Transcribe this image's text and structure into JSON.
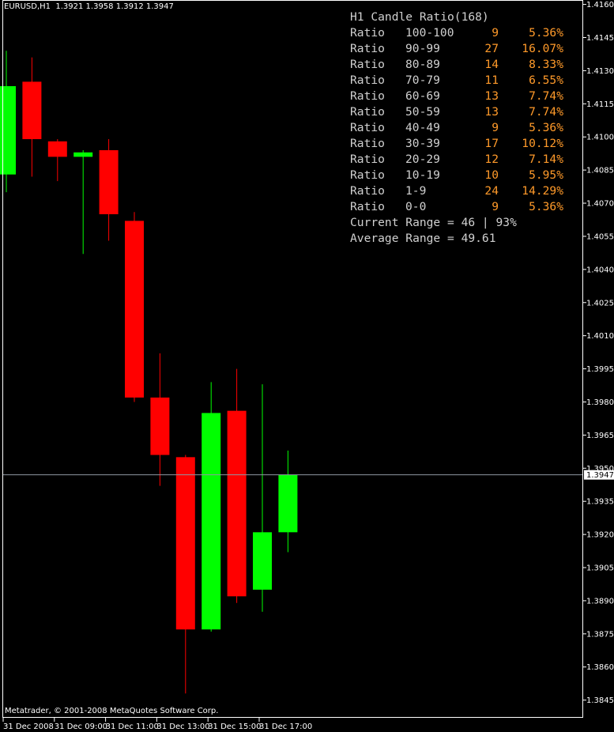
{
  "header": {
    "symbol_line": "EURUSD,H1  1.3921 1.3958 1.3912 1.3947"
  },
  "footer": {
    "copyright": "Metatrader, © 2001-2008 MetaQuotes Software Corp."
  },
  "colors": {
    "bull": "#00ff00",
    "bear": "#ff0000",
    "axis": "#ffffff",
    "price_line": "#8f97a3",
    "panel_text": "#d0d0d0",
    "panel_value": "#ff9a2a"
  },
  "ratio_panel": {
    "title": "H1 Candle Ratio(168)",
    "rows": [
      {
        "label": "Ratio",
        "bucket": "100-100",
        "count": "9",
        "pct": "5.36%"
      },
      {
        "label": "Ratio",
        "bucket": "90-99",
        "count": "27",
        "pct": "16.07%"
      },
      {
        "label": "Ratio",
        "bucket": "80-89",
        "count": "14",
        "pct": "8.33%"
      },
      {
        "label": "Ratio",
        "bucket": "70-79",
        "count": "11",
        "pct": "6.55%"
      },
      {
        "label": "Ratio",
        "bucket": "60-69",
        "count": "13",
        "pct": "7.74%"
      },
      {
        "label": "Ratio",
        "bucket": "50-59",
        "count": "13",
        "pct": "7.74%"
      },
      {
        "label": "Ratio",
        "bucket": "40-49",
        "count": "9",
        "pct": "5.36%"
      },
      {
        "label": "Ratio",
        "bucket": "30-39",
        "count": "17",
        "pct": "10.12%"
      },
      {
        "label": "Ratio",
        "bucket": "20-29",
        "count": "12",
        "pct": "7.14%"
      },
      {
        "label": "Ratio",
        "bucket": "10-19",
        "count": "10",
        "pct": "5.95%"
      },
      {
        "label": "Ratio",
        "bucket": "1-9",
        "count": "24",
        "pct": "14.29%"
      },
      {
        "label": "Ratio",
        "bucket": "0-0",
        "count": "9",
        "pct": "5.36%"
      }
    ],
    "current_range": "Current Range = 46 | 93%",
    "average_range": "Average Range = 49.61"
  },
  "chart_data": {
    "type": "candlestick",
    "ylim": [
      1.3837,
      1.4162
    ],
    "y_ticks": [
      "1.4160",
      "1.4145",
      "1.4130",
      "1.4115",
      "1.4100",
      "1.4085",
      "1.4070",
      "1.4055",
      "1.4040",
      "1.4025",
      "1.4010",
      "1.3995",
      "1.3980",
      "1.3965",
      "1.3950",
      "1.3935",
      "1.3920",
      "1.3905",
      "1.3890",
      "1.3875",
      "1.3860",
      "1.3845"
    ],
    "x_ticks": [
      {
        "label": "31 Dec 2008",
        "index": 0
      },
      {
        "label": "31 Dec 09:00",
        "index": 2
      },
      {
        "label": "31 Dec 11:00",
        "index": 4
      },
      {
        "label": "31 Dec 13:00",
        "index": 6
      },
      {
        "label": "31 Dec 15:00",
        "index": 8
      },
      {
        "label": "31 Dec 17:00",
        "index": 10
      }
    ],
    "current_price": "1.3947",
    "candles": [
      {
        "open": 1.4083,
        "high": 1.4139,
        "low": 1.4075,
        "close": 1.4123
      },
      {
        "open": 1.4125,
        "high": 1.4136,
        "low": 1.4082,
        "close": 1.4099
      },
      {
        "open": 1.4098,
        "high": 1.4099,
        "low": 1.408,
        "close": 1.4091
      },
      {
        "open": 1.4091,
        "high": 1.4094,
        "low": 1.4047,
        "close": 1.4093
      },
      {
        "open": 1.4094,
        "high": 1.4099,
        "low": 1.4053,
        "close": 1.4065
      },
      {
        "open": 1.4062,
        "high": 1.4066,
        "low": 1.398,
        "close": 1.3982
      },
      {
        "open": 1.3982,
        "high": 1.4002,
        "low": 1.3942,
        "close": 1.3956
      },
      {
        "open": 1.3955,
        "high": 1.3956,
        "low": 1.3848,
        "close": 1.3877
      },
      {
        "open": 1.3877,
        "high": 1.3989,
        "low": 1.3876,
        "close": 1.3975
      },
      {
        "open": 1.3976,
        "high": 1.3995,
        "low": 1.3889,
        "close": 1.3892
      },
      {
        "open": 1.3895,
        "high": 1.3988,
        "low": 1.3885,
        "close": 1.3921
      },
      {
        "open": 1.3921,
        "high": 1.3958,
        "low": 1.3912,
        "close": 1.3947
      }
    ]
  }
}
